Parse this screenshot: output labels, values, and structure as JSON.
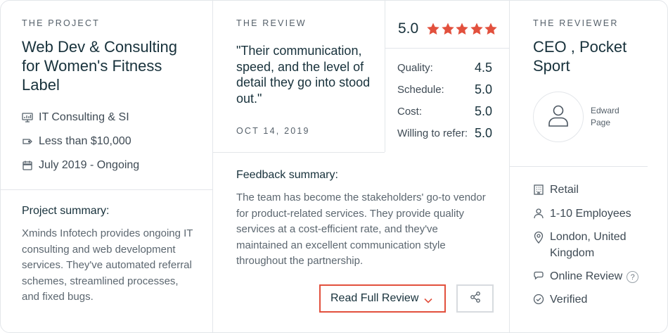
{
  "project": {
    "eyebrow": "THE PROJECT",
    "title_lines": [
      "Web Dev & Consulting",
      "for Women's Fitness",
      "Label"
    ],
    "meta": [
      {
        "icon": "monitor-chart-icon",
        "text": "IT Consulting & SI"
      },
      {
        "icon": "price-tag-icon",
        "text": "Less than $10,000"
      },
      {
        "icon": "calendar-icon",
        "text": "July 2019 - Ongoing"
      }
    ],
    "summary_label": "Project summary:",
    "summary_lines": [
      "Xminds Infotech provides ongoing IT",
      "consulting and web development",
      "services. They've automated referral",
      "schemes, streamlined processes,",
      "and fixed bugs."
    ]
  },
  "review": {
    "eyebrow": "THE REVIEW",
    "quote_lines": [
      "\"Their communication,",
      "speed, and the level of",
      "detail they go into stood",
      "out.\""
    ],
    "date": "OCT 14, 2019",
    "overall": "5.0",
    "star_count": 5,
    "scores": [
      {
        "label": "Quality:",
        "value": "4.5"
      },
      {
        "label": "Schedule:",
        "value": "5.0"
      },
      {
        "label": "Cost:",
        "value": "5.0"
      },
      {
        "label": "Willing to refer:",
        "value": "5.0"
      }
    ],
    "feedback_label": "Feedback summary:",
    "feedback_lines": [
      "The team has become the stakeholders' go-to vendor",
      "for product-related services. They provide quality",
      "services at a cost-efficient rate, and they've",
      "maintained an excellent communication style",
      "throughout the partnership."
    ],
    "read_button": "Read Full Review"
  },
  "reviewer": {
    "eyebrow": "THE REVIEWER",
    "title_lines": [
      "CEO , Pocket",
      "Sport"
    ],
    "name_lines": [
      "Edward",
      "Page"
    ],
    "details": [
      {
        "icon": "building-icon",
        "lines": [
          "Retail"
        ]
      },
      {
        "icon": "person-icon",
        "lines": [
          "1-10 Employees"
        ]
      },
      {
        "icon": "location-pin-icon",
        "lines": [
          "London, United",
          "Kingdom"
        ]
      },
      {
        "icon": "chat-bubble-icon",
        "lines": [
          "Online Review"
        ]
      },
      {
        "icon": "check-circle-icon",
        "lines": [
          "Verified"
        ]
      }
    ],
    "help_mark": "?"
  },
  "colors": {
    "accent": "#e2503d",
    "text_dark": "#17313b",
    "text_muted": "#5c6770",
    "divider": "#e3e6ea"
  }
}
